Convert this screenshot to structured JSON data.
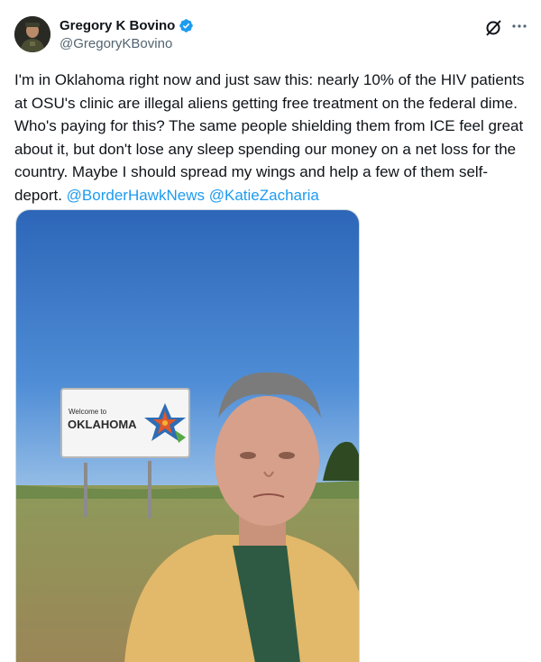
{
  "author": {
    "display_name": "Gregory K Bovino",
    "handle": "@GregoryKBovino",
    "verified_icon": "verified-badge-icon"
  },
  "tweet": {
    "body": "I'm in Oklahoma right now and just saw this: nearly 10% of the HIV patients at OSU's clinic are illegal aliens getting free treatment on the federal dime. Who's paying for this? The same people shielding them from ICE feel great about it, but don't lose any sleep spending our money on a net loss for the country. Maybe I should spread my wings and help a few of them self-deport.",
    "mentions": [
      "@BorderHawkNews",
      "@KatieZacharia"
    ]
  },
  "media": {
    "sign_line1": "Welcome to",
    "sign_line2": "OKLAHOMA"
  },
  "icons": {
    "grok": "grok-icon",
    "more": "more-options-icon"
  },
  "colors": {
    "accent": "#1d9bf0",
    "text": "#0f1419",
    "secondary": "#536471"
  }
}
